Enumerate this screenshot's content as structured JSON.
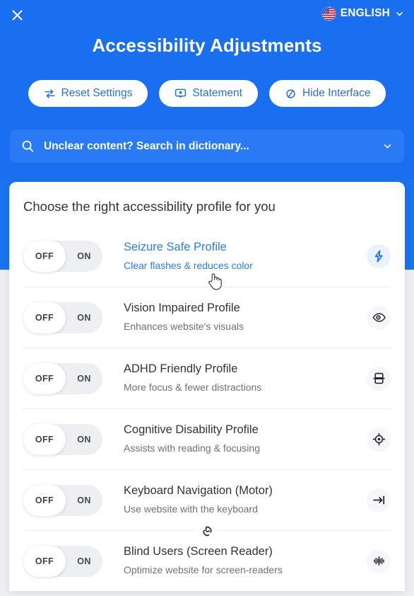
{
  "header": {
    "close_label": "Close",
    "close_icon": "close-icon",
    "language": {
      "label": "ENGLISH",
      "flag_icon": "us-flag-icon",
      "chevron_icon": "chevron-down-icon"
    },
    "title": "Accessibility Adjustments",
    "buttons": [
      {
        "label": "Reset Settings",
        "icon": "refresh-exchange-icon"
      },
      {
        "label": "Statement",
        "icon": "statement-badge-icon"
      },
      {
        "label": "Hide Interface",
        "icon": "hide-slash-icon"
      }
    ]
  },
  "search": {
    "placeholder": "Unclear content? Search in dictionary...",
    "value": "",
    "search_icon": "search-icon",
    "chevron_icon": "chevron-down-icon"
  },
  "card": {
    "title": "Choose the right accessibility profile for you",
    "toggle": {
      "off_label": "OFF",
      "on_label": "ON"
    },
    "divider_icon": "chain-link-icon",
    "profiles": [
      {
        "name": "Seizure Safe Profile",
        "description": "Clear flashes & reduces color",
        "state": "OFF",
        "icon": "lightning-bolt-icon",
        "highlighted": true
      },
      {
        "name": "Vision Impaired Profile",
        "description": "Enhances website's visuals",
        "state": "OFF",
        "icon": "eye-icon",
        "highlighted": false
      },
      {
        "name": "ADHD Friendly Profile",
        "description": "More focus & fewer distractions",
        "state": "OFF",
        "icon": "focus-band-icon",
        "highlighted": false
      },
      {
        "name": "Cognitive Disability Profile",
        "description": "Assists with reading & focusing",
        "state": "OFF",
        "icon": "target-crosshair-icon",
        "highlighted": false
      },
      {
        "name": "Keyboard Navigation (Motor)",
        "description": "Use website with the keyboard",
        "state": "OFF",
        "icon": "arrow-to-bar-icon",
        "highlighted": false
      },
      {
        "name": "Blind Users (Screen Reader)",
        "description": "Optimize website for screen-readers",
        "state": "OFF",
        "icon": "audio-waveform-icon",
        "highlighted": false
      }
    ]
  },
  "colors": {
    "brand_blue": "#1a6ff0",
    "search_blue": "#2a7af5",
    "backdrop_grey": "#eceef1",
    "accent_link": "#2b7de9",
    "button_text": "#2b6fd4"
  },
  "cursor": {
    "type": "pointer-hand-cursor"
  }
}
